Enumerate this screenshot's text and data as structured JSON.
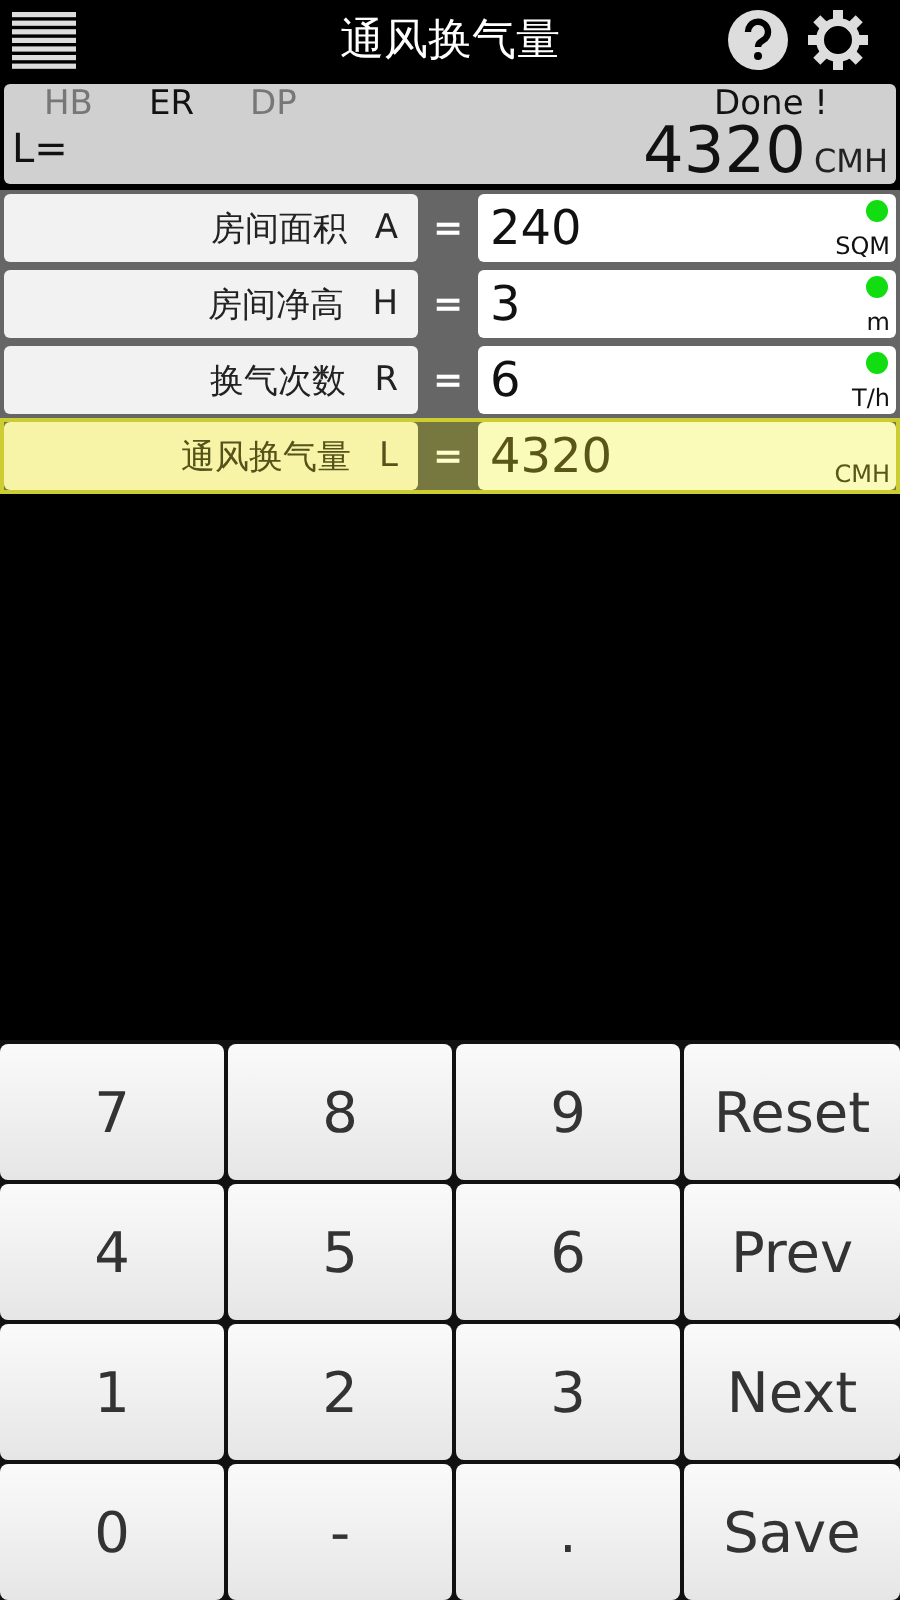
{
  "header": {
    "title": "通风换气量"
  },
  "modes": [
    {
      "label": "HB",
      "selected": false
    },
    {
      "label": "ER",
      "selected": true
    },
    {
      "label": "DP",
      "selected": false
    }
  ],
  "summary": {
    "status": "Done !",
    "label": "L=",
    "value": "4320",
    "unit": "CMH"
  },
  "rows": [
    {
      "label": "房间面积",
      "symbol": "A",
      "equals": "=",
      "value": "240",
      "unit": "SQM",
      "indicator": true,
      "selected": false
    },
    {
      "label": "房间净高",
      "symbol": "H",
      "equals": "=",
      "value": "3",
      "unit": "m",
      "indicator": true,
      "selected": false
    },
    {
      "label": "换气次数",
      "symbol": "R",
      "equals": "=",
      "value": "6",
      "unit": "T/h",
      "indicator": true,
      "selected": false
    },
    {
      "label": "通风换气量",
      "symbol": "L",
      "equals": "=",
      "value": "4320",
      "unit": "CMH",
      "indicator": false,
      "selected": true
    }
  ],
  "keypad": [
    [
      "7",
      "8",
      "9",
      "Reset"
    ],
    [
      "4",
      "5",
      "6",
      "Prev"
    ],
    [
      "1",
      "2",
      "3",
      "Next"
    ],
    [
      "0",
      "-",
      ".",
      "Save"
    ]
  ]
}
